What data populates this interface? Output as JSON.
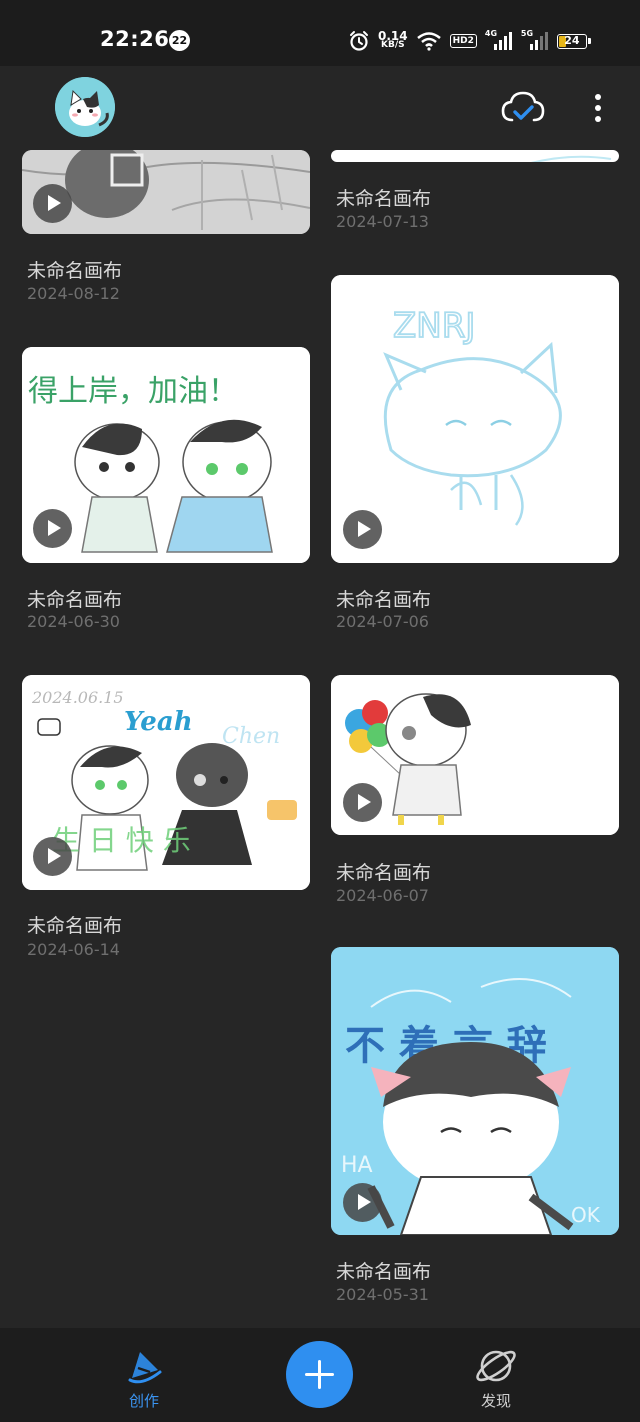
{
  "status_bar": {
    "time": "22:26",
    "notification_count": "22",
    "net_speed_value": "0.14",
    "net_speed_unit": "KB/S",
    "hd_label": "HD2",
    "signal1_label": "4G",
    "signal2_label": "5G",
    "battery_level": "24",
    "icons": [
      "alarm-icon",
      "wifi-icon",
      "hd-icon",
      "signal-4g-icon",
      "signal-5g-icon",
      "battery-icon"
    ]
  },
  "header": {
    "avatar": "avatar",
    "icons": [
      "cloud-sync-icon",
      "more-vert-icon"
    ]
  },
  "canvases": [
    {
      "title": "未命名画布",
      "date": "2024-08-12",
      "thumb_color": "#cfcfcf"
    },
    {
      "title": "未命名画布",
      "date": "2024-07-13",
      "thumb_color": "#ffffff"
    },
    {
      "title": "未命名画布",
      "date": "2024-06-30",
      "thumb_color": "#ffffff",
      "thumb_text": "得上岸，加油！"
    },
    {
      "title": "未命名画布",
      "date": "2024-07-06",
      "thumb_color": "#ffffff",
      "thumb_text": "ZNRJ"
    },
    {
      "title": "未命名画布",
      "date": "2024-06-14",
      "thumb_color": "#ffffff",
      "thumb_text": "Yeah",
      "thumb_text2": "2024.06.15",
      "thumb_text3": "Chen"
    },
    {
      "title": "未命名画布",
      "date": "2024-06-07",
      "thumb_color": "#ffffff"
    },
    {
      "title": "未命名画布",
      "date": "2024-05-31",
      "thumb_color": "#8ed8f2",
      "thumb_text": "不 着 言 辞"
    }
  ],
  "bottom_nav": {
    "create_label": "创作",
    "discover_label": "发现",
    "accent": "#2f8ff0"
  }
}
